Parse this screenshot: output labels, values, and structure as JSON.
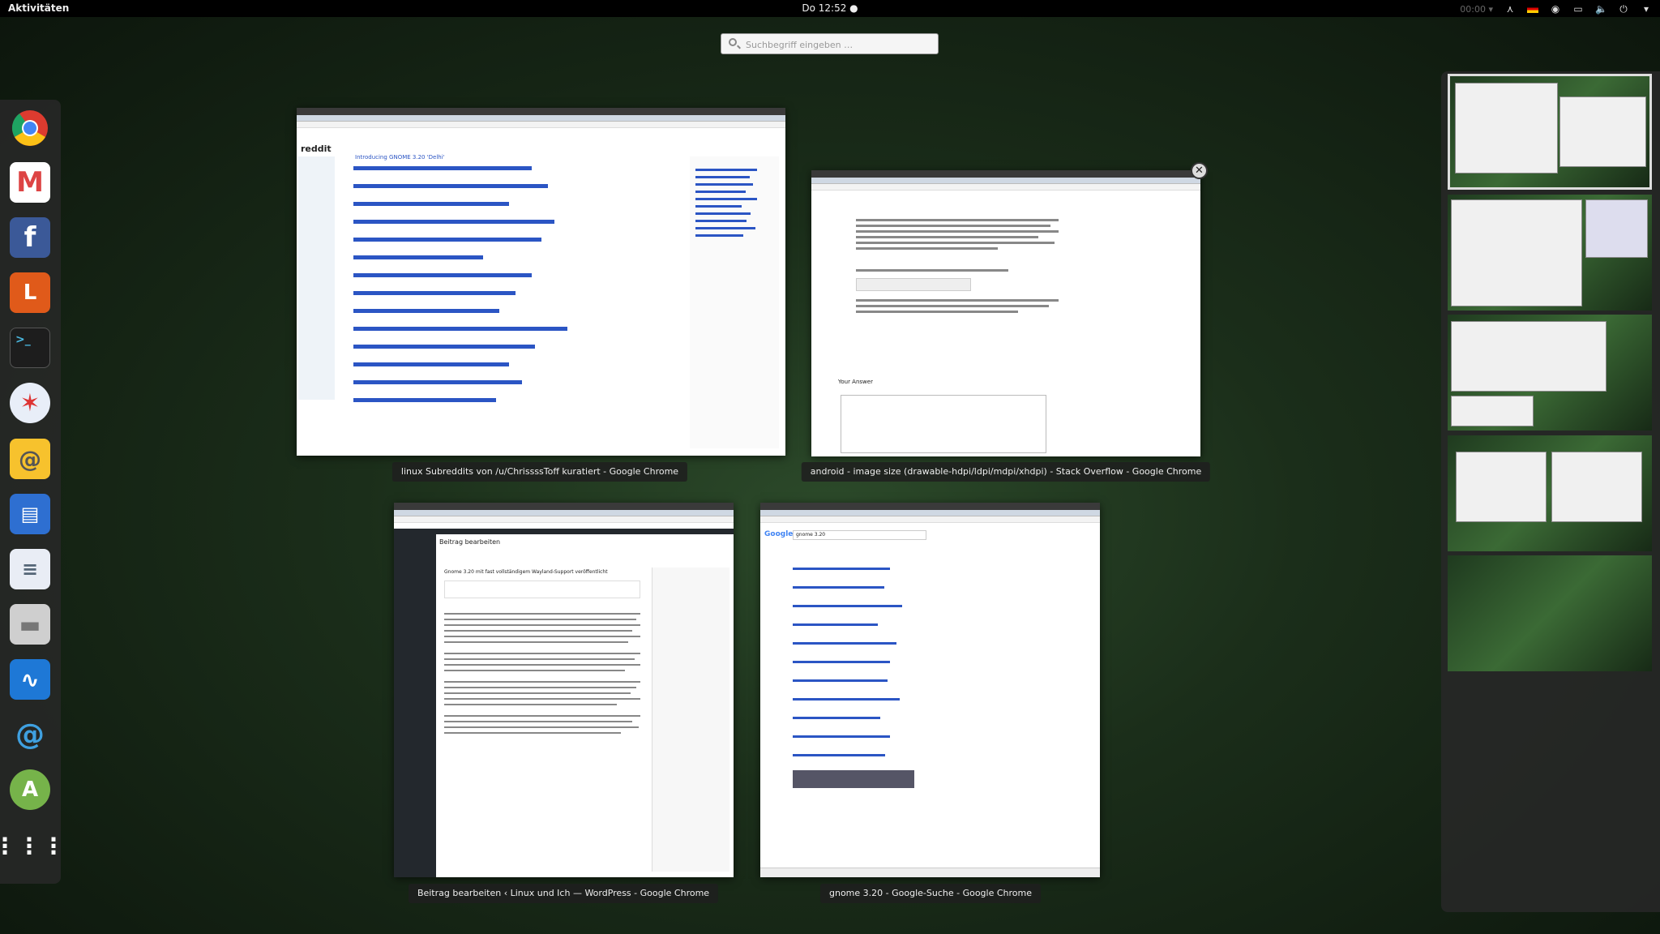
{
  "topbar": {
    "activities": "Aktivitäten",
    "clock": "Do 12:52",
    "timer": "00:00",
    "icons": [
      "accessibility-icon",
      "keyboard-layout-flag-icon",
      "chat-icon",
      "display-icon",
      "volume-icon",
      "power-icon",
      "chevron-down-icon"
    ]
  },
  "search": {
    "placeholder": "Suchbegriff eingeben …"
  },
  "dash": {
    "apps": [
      {
        "name": "chrome-icon",
        "color": "#dd3b2f"
      },
      {
        "name": "gmail-icon",
        "color": "#ffffff"
      },
      {
        "name": "facebook-icon",
        "color": "#3b5998"
      },
      {
        "name": "l-app-icon",
        "color": "#e05a1a"
      },
      {
        "name": "terminal-icon",
        "color": "#222222"
      },
      {
        "name": "safari-icon",
        "color": "#3b7fe0"
      },
      {
        "name": "mail-icon",
        "color": "#f7c22d"
      },
      {
        "name": "document-viewer-icon",
        "color": "#2e6fd1"
      },
      {
        "name": "text-editor-icon",
        "color": "#e9edf5"
      },
      {
        "name": "files-icon",
        "color": "#cfcfcf"
      },
      {
        "name": "system-monitor-icon",
        "color": "#1e78d6"
      },
      {
        "name": "spiral-app-icon",
        "color": "#3fa0e0"
      },
      {
        "name": "android-studio-icon",
        "color": "#76b34a"
      },
      {
        "name": "show-apps-icon",
        "color": "#ffffff"
      }
    ],
    "letters": {
      "facebook": "f",
      "l_app": "L",
      "gmail": "M",
      "mail": "@"
    }
  },
  "windows": [
    {
      "caption": "linux Subreddits von /u/ChrissssToff kuratiert - Google Chrome",
      "logo": "reddit",
      "headline": "Introducing GNOME 3.20 'Delhi'"
    },
    {
      "caption": "android - image size (drawable-hdpi/ldpi/mdpi/xhdpi) - Stack Overflow - Google Chrome",
      "answer_label": "Your Answer"
    },
    {
      "caption": "Beitrag bearbeiten ‹ Linux und Ich — WordPress - Google Chrome",
      "heading": "Beitrag bearbeiten",
      "post_title": "Gnome 3.20 mit fast vollständigem Wayland-Support veröffentlicht"
    },
    {
      "caption": "gnome 3.20 - Google-Suche - Google Chrome",
      "logo": "Google",
      "query": "gnome 3.20"
    }
  ]
}
